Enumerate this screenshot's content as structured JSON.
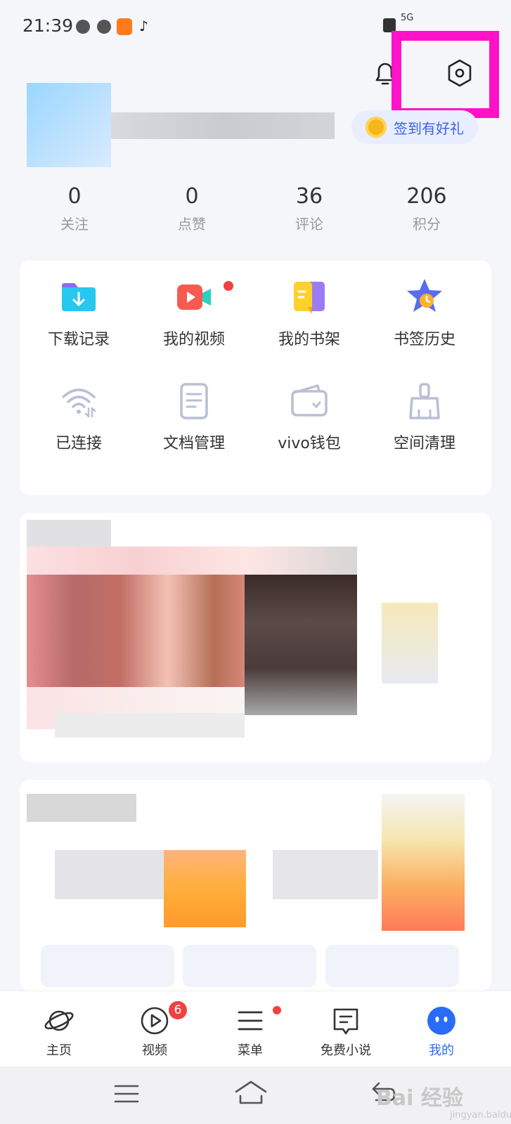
{
  "status_bar": {
    "time": "21:39",
    "network": "5G",
    "app_icons": [
      "speed-icon",
      "volume-icon",
      "taobao-icon",
      "tiktok-icon"
    ]
  },
  "header": {
    "bell_icon": "bell-icon",
    "settings_icon": "settings-icon",
    "signin_label": "签到有好礼"
  },
  "stats": [
    {
      "value": "0",
      "label": "关注"
    },
    {
      "value": "0",
      "label": "点赞"
    },
    {
      "value": "36",
      "label": "评论"
    },
    {
      "value": "206",
      "label": "积分"
    }
  ],
  "tools": [
    {
      "label": "下载记录",
      "icon": "download-folder-icon"
    },
    {
      "label": "我的视频",
      "icon": "video-camera-icon"
    },
    {
      "label": "我的书架",
      "icon": "bookshelf-icon"
    },
    {
      "label": "书签历史",
      "icon": "bookmark-history-icon"
    },
    {
      "label": "已连接",
      "icon": "wifi-icon"
    },
    {
      "label": "文档管理",
      "icon": "document-icon"
    },
    {
      "label": "vivo钱包",
      "icon": "wallet-icon"
    },
    {
      "label": "空间清理",
      "icon": "broom-icon"
    }
  ],
  "bottom_nav": [
    {
      "label": "主页",
      "icon": "planet-icon"
    },
    {
      "label": "视频",
      "icon": "play-icon",
      "badge": "6"
    },
    {
      "label": "菜单",
      "icon": "menu-icon"
    },
    {
      "label": "免费小说",
      "icon": "book-icon"
    },
    {
      "label": "我的",
      "icon": "profile-face-icon",
      "active": true
    }
  ],
  "system_nav": [
    "menu-icon",
    "home-icon",
    "back-icon"
  ],
  "watermark": {
    "text": "Bai 经验",
    "sub": "jingyan.baidu.com"
  },
  "colors": {
    "accent": "#2a6cf6",
    "highlight": "#ff12c8",
    "badge": "#f04040"
  }
}
